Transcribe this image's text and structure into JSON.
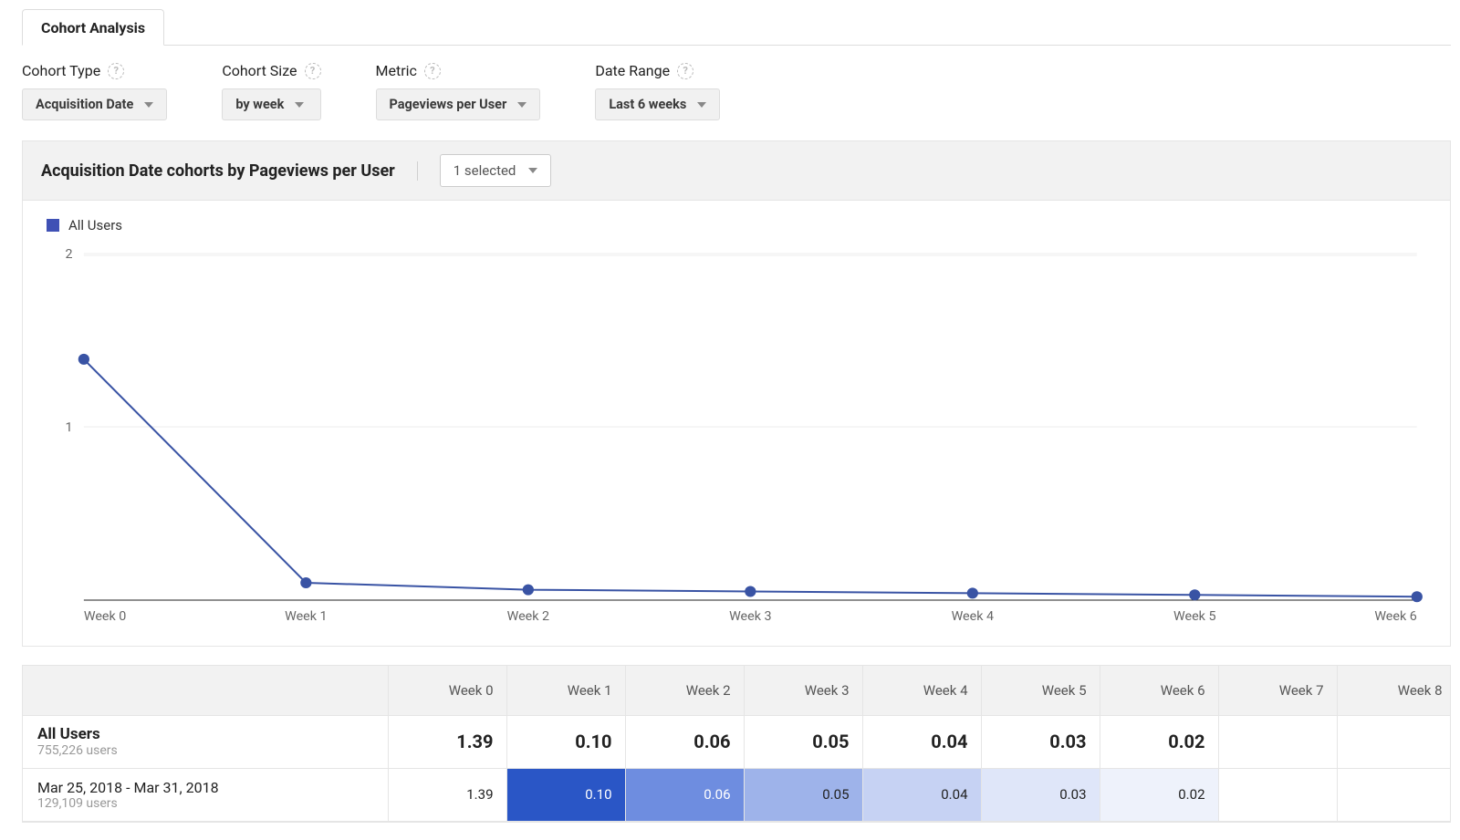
{
  "tab": {
    "label": "Cohort Analysis"
  },
  "controls": {
    "cohort_type": {
      "label": "Cohort Type",
      "value": "Acquisition Date"
    },
    "cohort_size": {
      "label": "Cohort Size",
      "value": "by week"
    },
    "metric": {
      "label": "Metric",
      "value": "Pageviews per User"
    },
    "date_range": {
      "label": "Date Range",
      "value": "Last 6 weeks"
    }
  },
  "panel": {
    "title": "Acquisition Date cohorts by Pageviews per User",
    "segment_selected": "1 selected"
  },
  "legend": {
    "series_name": "All Users"
  },
  "chart_data": {
    "type": "line",
    "x": [
      "Week 0",
      "Week 1",
      "Week 2",
      "Week 3",
      "Week 4",
      "Week 5",
      "Week 6"
    ],
    "values": [
      1.39,
      0.1,
      0.06,
      0.05,
      0.04,
      0.03,
      0.02
    ],
    "ylim": [
      0,
      2
    ],
    "yticks": [
      1,
      2
    ],
    "series_name": "All Users"
  },
  "table": {
    "columns": [
      "Week 0",
      "Week 1",
      "Week 2",
      "Week 3",
      "Week 4",
      "Week 5",
      "Week 6",
      "Week 7",
      "Week 8"
    ],
    "rows": [
      {
        "title": "All Users",
        "subtitle": "755,226 users",
        "bold": true,
        "cells": [
          "1.39",
          "0.10",
          "0.06",
          "0.05",
          "0.04",
          "0.03",
          "0.02",
          "",
          ""
        ],
        "heat": [
          "",
          "",
          "",
          "",
          "",
          "",
          "",
          "",
          ""
        ]
      },
      {
        "title": "Mar 25, 2018 - Mar 31, 2018",
        "subtitle": "129,109 users",
        "bold": false,
        "cells": [
          "1.39",
          "0.10",
          "0.06",
          "0.05",
          "0.04",
          "0.03",
          "0.02",
          "",
          ""
        ],
        "heat": [
          "",
          "heat-1",
          "heat-2",
          "heat-3",
          "heat-4",
          "heat-5",
          "heat-6",
          "",
          ""
        ]
      }
    ]
  }
}
